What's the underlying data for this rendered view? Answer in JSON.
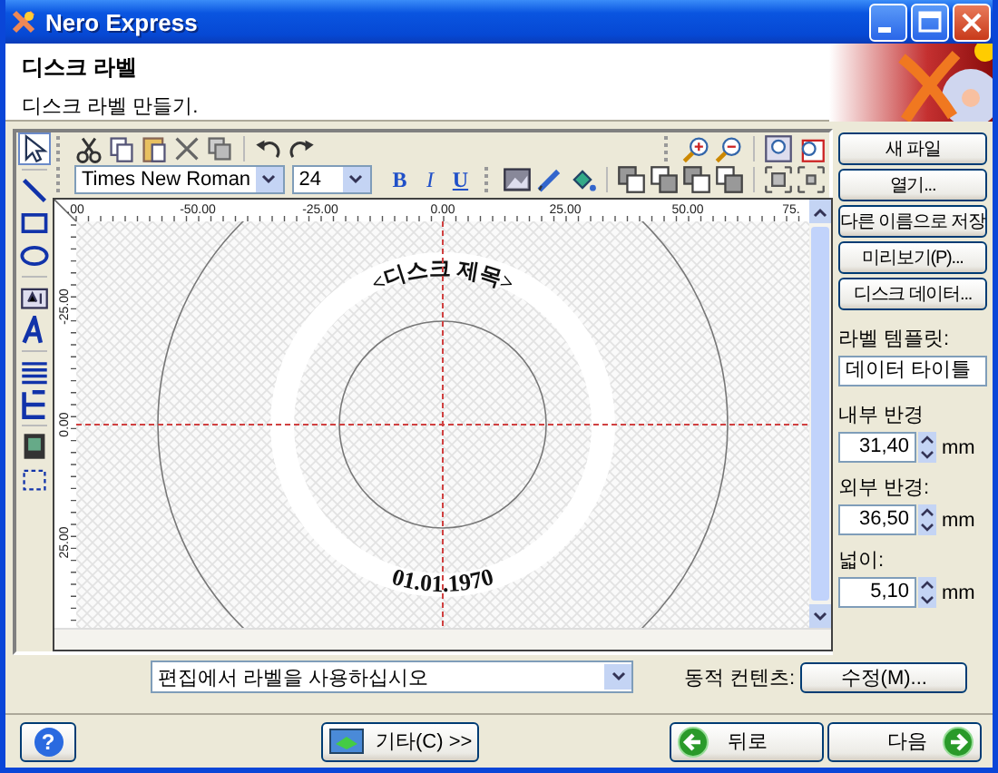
{
  "window": {
    "title": "Nero Express"
  },
  "header": {
    "title": "디스크 라벨",
    "subtitle": "디스크 라벨 만들기."
  },
  "font_bar": {
    "font": "Times New Roman",
    "size": "24",
    "format": [
      "B",
      "I",
      "U"
    ]
  },
  "ruler": {
    "x_labels": [
      ".00",
      "-50.00",
      "-25.00",
      "0.00",
      "25.00",
      "50.00",
      "75."
    ],
    "y_labels": [
      "-25.00",
      "0.00",
      "25.00"
    ]
  },
  "disc": {
    "title": "<디스크 제목>",
    "date": "01.01.1970"
  },
  "side_buttons": [
    "새 파일",
    "열기...",
    "다른 이름으로 저장",
    "미리보기(P)...",
    "디스크 데이터..."
  ],
  "template": {
    "label": "라벨 템플릿:",
    "value": "데이터 타이틀"
  },
  "fields": [
    {
      "label": "내부 반경",
      "value": "31,40",
      "unit": "mm"
    },
    {
      "label": "외부 반경:",
      "value": "36,50",
      "unit": "mm"
    },
    {
      "label": "넓이:",
      "value": "5,10",
      "unit": "mm"
    }
  ],
  "usage": {
    "value": "편집에서 라벨을 사용하십시오"
  },
  "dynamic": {
    "label": "동적 컨텐츠:",
    "button": "수정(M)..."
  },
  "footer": {
    "help": "?",
    "more": "기타(C) >>",
    "back": "뒤로",
    "next": "다음"
  }
}
